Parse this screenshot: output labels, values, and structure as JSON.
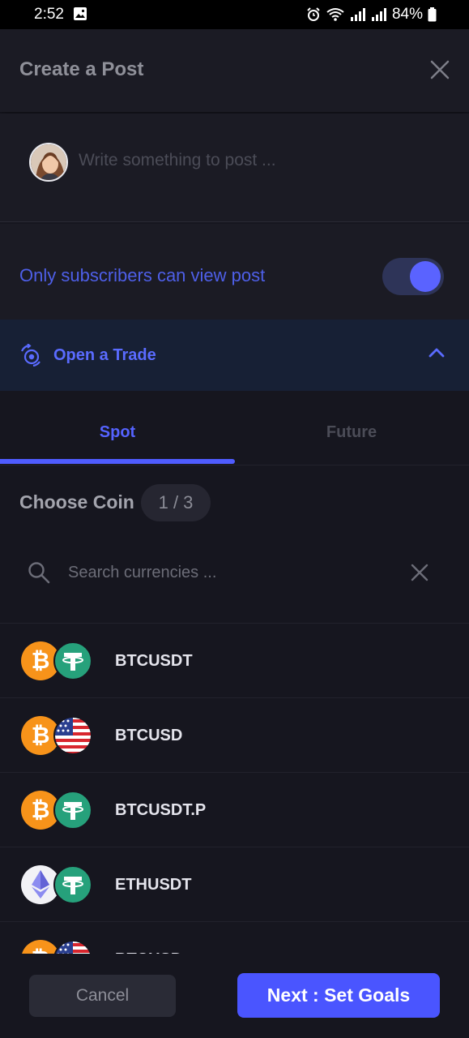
{
  "statusbar": {
    "time": "2:52",
    "battery": "84%"
  },
  "header": {
    "title": "Create a Post"
  },
  "compose": {
    "placeholder": "Write something to post ..."
  },
  "subscribers": {
    "label": "Only subscribers can view post",
    "enabled": true
  },
  "trade": {
    "label": "Open a Trade",
    "expanded": true
  },
  "tabs": [
    {
      "label": "Spot",
      "active": true
    },
    {
      "label": "Future",
      "active": false
    }
  ],
  "choose": {
    "label": "Choose Coin",
    "step": "1 / 3"
  },
  "search": {
    "placeholder": "Search currencies ..."
  },
  "pairs": [
    {
      "symbol": "BTCUSDT",
      "base": "bitcoin-icon",
      "quote": "tether-icon"
    },
    {
      "symbol": "BTCUSD",
      "base": "bitcoin-icon",
      "quote": "usd-flag-icon"
    },
    {
      "symbol": "BTCUSDT.P",
      "base": "bitcoin-icon",
      "quote": "tether-icon"
    },
    {
      "symbol": "ETHUSDT",
      "base": "ethereum-icon",
      "quote": "tether-icon"
    },
    {
      "symbol": "BTCUSD",
      "base": "bitcoin-icon",
      "quote": "usd-flag-icon"
    }
  ],
  "footer": {
    "cancel_label": "Cancel",
    "next_label": "Next : Set Goals"
  },
  "colors": {
    "accent": "#4a55ff",
    "bitcoin": "#f7931a",
    "tether": "#26a17b",
    "background": "#16161f"
  }
}
